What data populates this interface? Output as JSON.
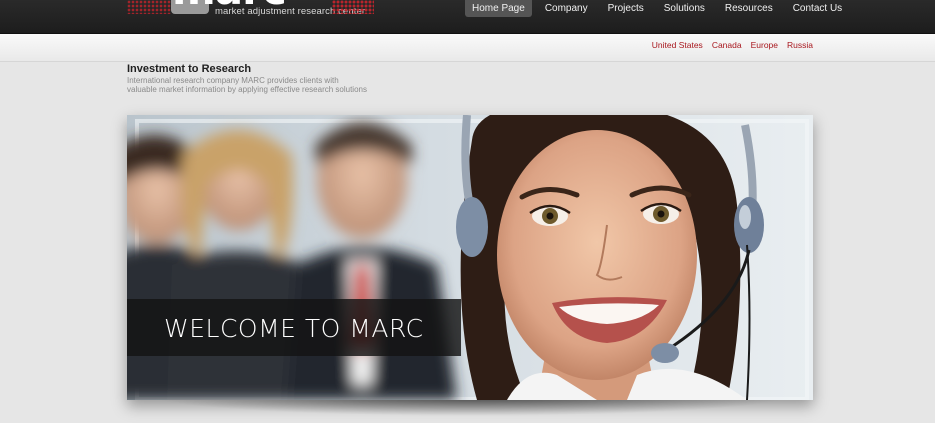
{
  "logo": {
    "word": "marc",
    "tagline": "market adjustment research center"
  },
  "nav": {
    "items": [
      {
        "label": "Home Page",
        "active": true
      },
      {
        "label": "Company"
      },
      {
        "label": "Projects"
      },
      {
        "label": "Solutions"
      },
      {
        "label": "Resources"
      },
      {
        "label": "Contact Us"
      }
    ]
  },
  "regions": [
    "United States",
    "Canada",
    "Europe",
    "Russia"
  ],
  "intro": {
    "title": "Investment to Research",
    "text": "International research company MARC provides clients with valuable market information by applying effective research solutions"
  },
  "hero": {
    "welcome": "WELCOME TO MARC"
  },
  "colors": {
    "accent_red": "#a8171e",
    "header_bg": "#222222",
    "page_bg": "#e6e6e6"
  }
}
